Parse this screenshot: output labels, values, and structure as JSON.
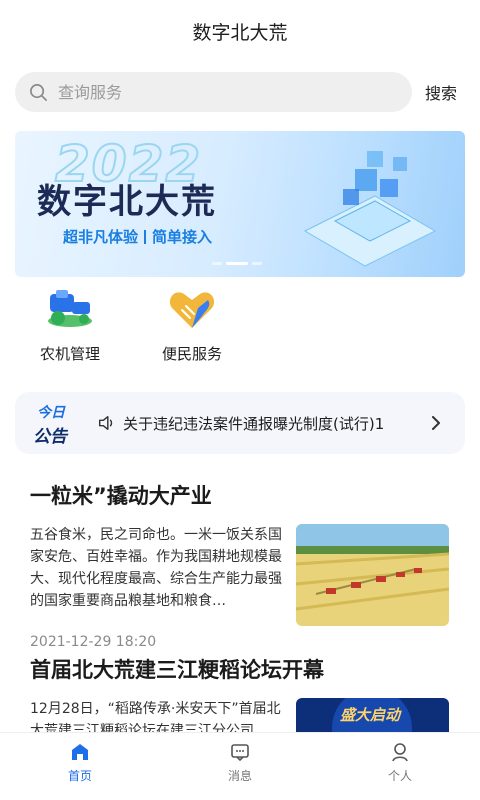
{
  "header": {
    "title": "数字北大荒"
  },
  "search": {
    "placeholder": "查询服务",
    "button_label": "搜索"
  },
  "banner": {
    "year": "2022",
    "title": "数字北大荒",
    "tagline_left": "超非凡体验",
    "tagline_right": "简单接入",
    "active_slide": 2,
    "slide_count": 3
  },
  "shortcuts": [
    {
      "label": "农机管理",
      "icon": "tractor-icon"
    },
    {
      "label": "便民服务",
      "icon": "handshake-heart-icon"
    }
  ],
  "notice": {
    "badge_top": "今日",
    "badge_bottom": "公告",
    "text": "关于违纪违法案件通报曝光制度(试行)1"
  },
  "articles": [
    {
      "title": "一粒米”撬动大产业",
      "desc": "五谷食米，民之司命也。一米一饭关系国家安危、百姓幸福。作为我国耕地规模最大、现代化程度最高、综合生产能力最强的国家重要商品粮基地和粮食…",
      "date": "2021-12-29 18:20"
    },
    {
      "title": "首届北大荒建三江粳稻论坛开幕",
      "desc": "12月28日，“稻路传承·米安天下”首届北大荒建三江粳稻论坛在建三江分公司",
      "date": "",
      "image_caption": "盛大启动"
    }
  ],
  "tabbar": [
    {
      "label": "首页",
      "icon": "home-icon",
      "active": true
    },
    {
      "label": "消息",
      "icon": "message-icon",
      "active": false
    },
    {
      "label": "个人",
      "icon": "person-icon",
      "active": false
    }
  ],
  "colors": {
    "accent": "#1d6ee8",
    "text": "#1e1e1e",
    "muted": "#8a8a8a"
  }
}
